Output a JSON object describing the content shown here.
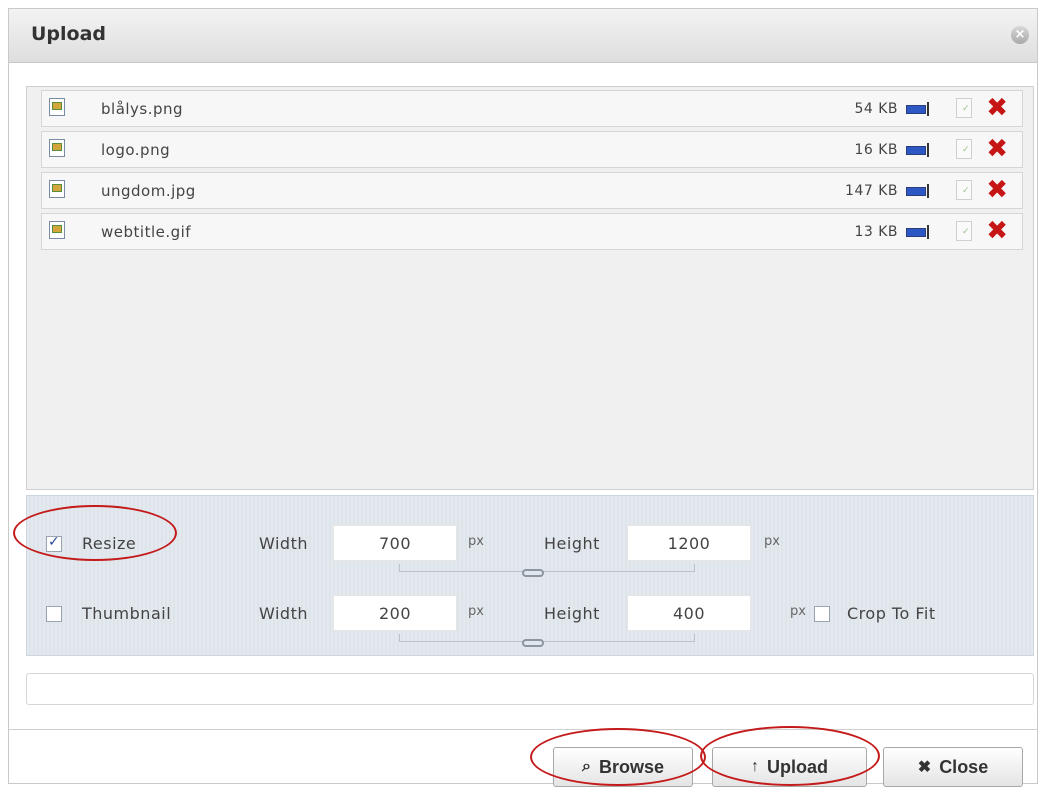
{
  "dialog": {
    "title": "Upload",
    "close_glyph": "×"
  },
  "files": [
    {
      "name": "blålys.png",
      "size": "54 KB"
    },
    {
      "name": "logo.png",
      "size": "16 KB"
    },
    {
      "name": "ungdom.jpg",
      "size": "147 KB"
    },
    {
      "name": "webtitle.gif",
      "size": "13 KB"
    }
  ],
  "resize": {
    "label": "Resize",
    "checked": true,
    "width_label": "Width",
    "width_value": "700",
    "width_unit": "px",
    "height_label": "Height",
    "height_value": "1200",
    "height_unit": "px"
  },
  "thumbnail": {
    "label": "Thumbnail",
    "checked": false,
    "width_label": "Width",
    "width_value": "200",
    "width_unit": "px",
    "height_label": "Height",
    "height_value": "400",
    "height_unit": "px",
    "crop_label": "Crop To Fit",
    "crop_checked": false
  },
  "buttons": {
    "browse_label": "Browse",
    "upload_label": "Upload",
    "close_label": "Close",
    "browse_icon": "search-icon",
    "upload_icon": "arrow-up-icon",
    "close_icon": "x-icon"
  },
  "colors": {
    "annotation_red": "#c41a1a",
    "delete_red": "#c61515",
    "resize_blue": "#2d57c4"
  }
}
